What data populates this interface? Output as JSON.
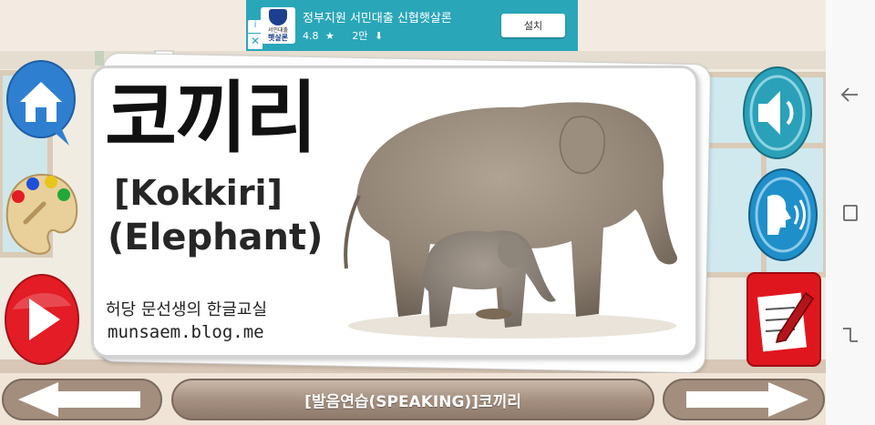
{
  "ad": {
    "title": "정부지원 서민대출 신협햇살론",
    "rating": "4.8",
    "downloads": "2만",
    "install_label": "설치",
    "logo_line1": "서민대출",
    "logo_line2": "햇살론",
    "info_glyph": "i",
    "close_glyph": "✕",
    "star_glyph": "★",
    "download_glyph": "⬇",
    "bg_color": "#2aa6b9"
  },
  "card": {
    "word_korean": "코끼리",
    "word_romanized": "[Kokkiri]",
    "word_english": "(Elephant)",
    "credit_korean": "허당 문선생의 한글교실",
    "credit_url": "munsaem.blog.me"
  },
  "bottom": {
    "title": "[발음연습(SPEAKING)]코끼리"
  },
  "icons": {
    "home": "home-icon",
    "palette": "palette-icon",
    "play": "play-icon",
    "sound": "speaker-icon",
    "speak": "speaking-head-icon",
    "quiz": "pencil-note-icon",
    "prev": "arrow-left-icon",
    "next": "arrow-right-icon",
    "back": "back-icon",
    "recents": "recents-icon",
    "overview": "overview-icon"
  },
  "colors": {
    "home_button": "#2f7fd0",
    "play_button": "#e31c25",
    "sound_button": "#2aa1b9",
    "quiz_button": "#e0161e",
    "title_pill": "#a38e7e"
  }
}
